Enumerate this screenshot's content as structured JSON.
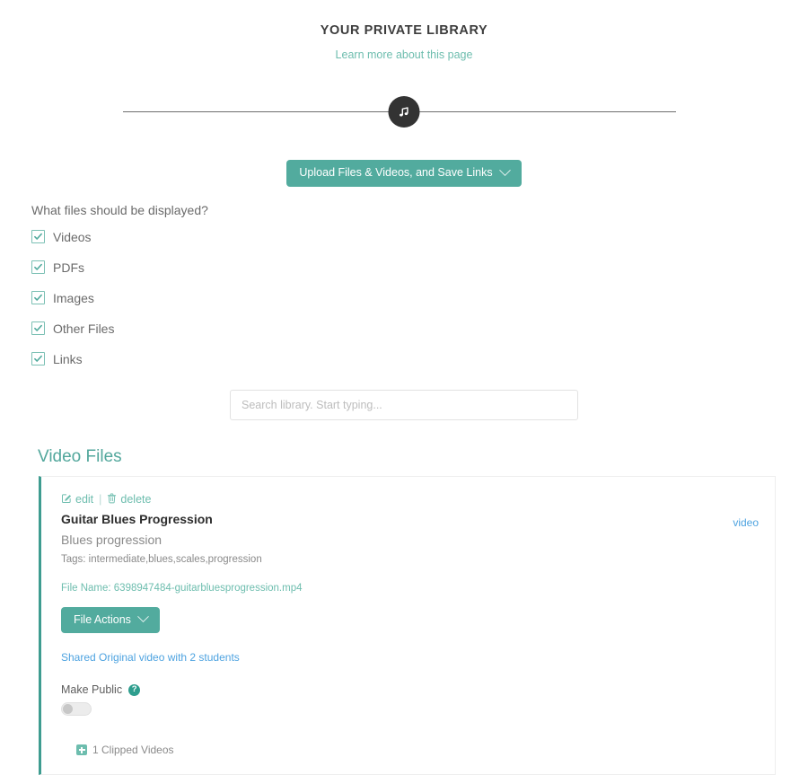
{
  "header": {
    "title": "YOUR PRIVATE LIBRARY",
    "learn_more_label": "Learn more about this page",
    "divider_icon": "music-note-icon"
  },
  "toolbar": {
    "upload_label": "Upload Files & Videos, and Save Links",
    "upload_chevron_icon": "chevron-down-icon"
  },
  "filters": {
    "question": "What files should be displayed?",
    "options": [
      {
        "label": "Videos",
        "checked": true
      },
      {
        "label": "PDFs",
        "checked": true
      },
      {
        "label": "Images",
        "checked": true
      },
      {
        "label": "Other Files",
        "checked": true
      },
      {
        "label": "Links",
        "checked": true
      }
    ]
  },
  "search": {
    "placeholder": "Search library. Start typing...",
    "value": ""
  },
  "section": {
    "heading": "Video Files"
  },
  "file_card": {
    "edit_label": "edit",
    "edit_icon": "pencil-square-icon",
    "separator": "|",
    "delete_label": "delete",
    "delete_icon": "trash-icon",
    "title": "Guitar Blues Progression",
    "description": "Blues progression",
    "tags": "Tags: intermediate,blues,scales,progression",
    "file_name": "File Name: 6398947484-guitarbluesprogression.mp4",
    "file_actions_label": "File Actions",
    "file_actions_chevron_icon": "chevron-down-icon",
    "shared_label": "Shared Original video with 2 students",
    "make_public_label": "Make Public",
    "help_icon_glyph": "?",
    "make_public_on": false,
    "clipped_label": "1 Clipped Videos",
    "clipped_icon": "plus-square-icon",
    "type_badge": "video"
  },
  "colors": {
    "teal": "#52ab9e",
    "teal_light": "#6dbdae",
    "teal_heading": "#52a79c",
    "accent_border": "#3e9c90",
    "blue_link": "#4ea3e0",
    "text_dark": "#2d2d2d",
    "text_muted": "#8a8a8a",
    "divider_dark": "#333333"
  }
}
